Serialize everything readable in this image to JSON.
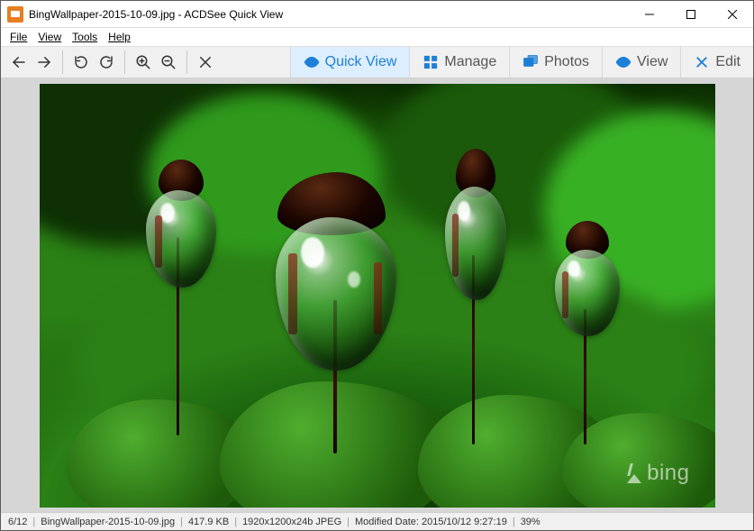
{
  "title": "BingWallpaper-2015-10-09.jpg - ACDSee Quick View",
  "menu": {
    "file": "File",
    "view": "View",
    "tools": "Tools",
    "help": "Help"
  },
  "modes": {
    "quick_view": "Quick View",
    "manage": "Manage",
    "photos": "Photos",
    "view": "View",
    "edit": "Edit"
  },
  "watermark": "bing",
  "status": {
    "position": "6/12",
    "filename": "BingWallpaper-2015-10-09.jpg",
    "filesize": "417.9 KB",
    "dimensions": "1920x1200x24b JPEG",
    "modified_label": "Modified Date:",
    "modified_value": "2015/10/12 9:27:19",
    "zoom": "39%"
  }
}
